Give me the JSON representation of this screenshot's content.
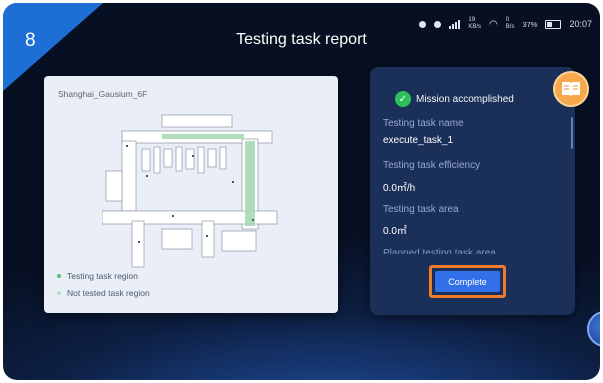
{
  "header": {
    "step_number": "8",
    "title": "Testing task report"
  },
  "status_bar": {
    "net_speed": "19",
    "net_speed_unit": "KB/s",
    "wifi_speed": "0",
    "wifi_speed_unit": "B/s",
    "battery": "37%",
    "time": "20:07"
  },
  "map": {
    "name": "Shanghai_Gausium_6F",
    "legend": [
      {
        "label": "Testing task region",
        "color": "#4ec276"
      },
      {
        "label": "Not tested task region",
        "color": "#b7e3c5"
      }
    ]
  },
  "report": {
    "status": "Mission accomplished",
    "fields": [
      {
        "label": "Testing task name",
        "value": "execute_task_1"
      },
      {
        "label": "Testing task efficiency",
        "value": "0.0㎡/h"
      },
      {
        "label": "Testing task area",
        "value": "0.0㎡"
      }
    ],
    "partial_label": "Planned testing task area",
    "complete_button": "Complete"
  },
  "icons": {
    "report": "book-icon",
    "status": "check-circle-icon"
  },
  "colors": {
    "accent": "#3170e8",
    "highlight": "#ef7c2a",
    "success": "#2fc05e",
    "book": "#f7a84a"
  }
}
